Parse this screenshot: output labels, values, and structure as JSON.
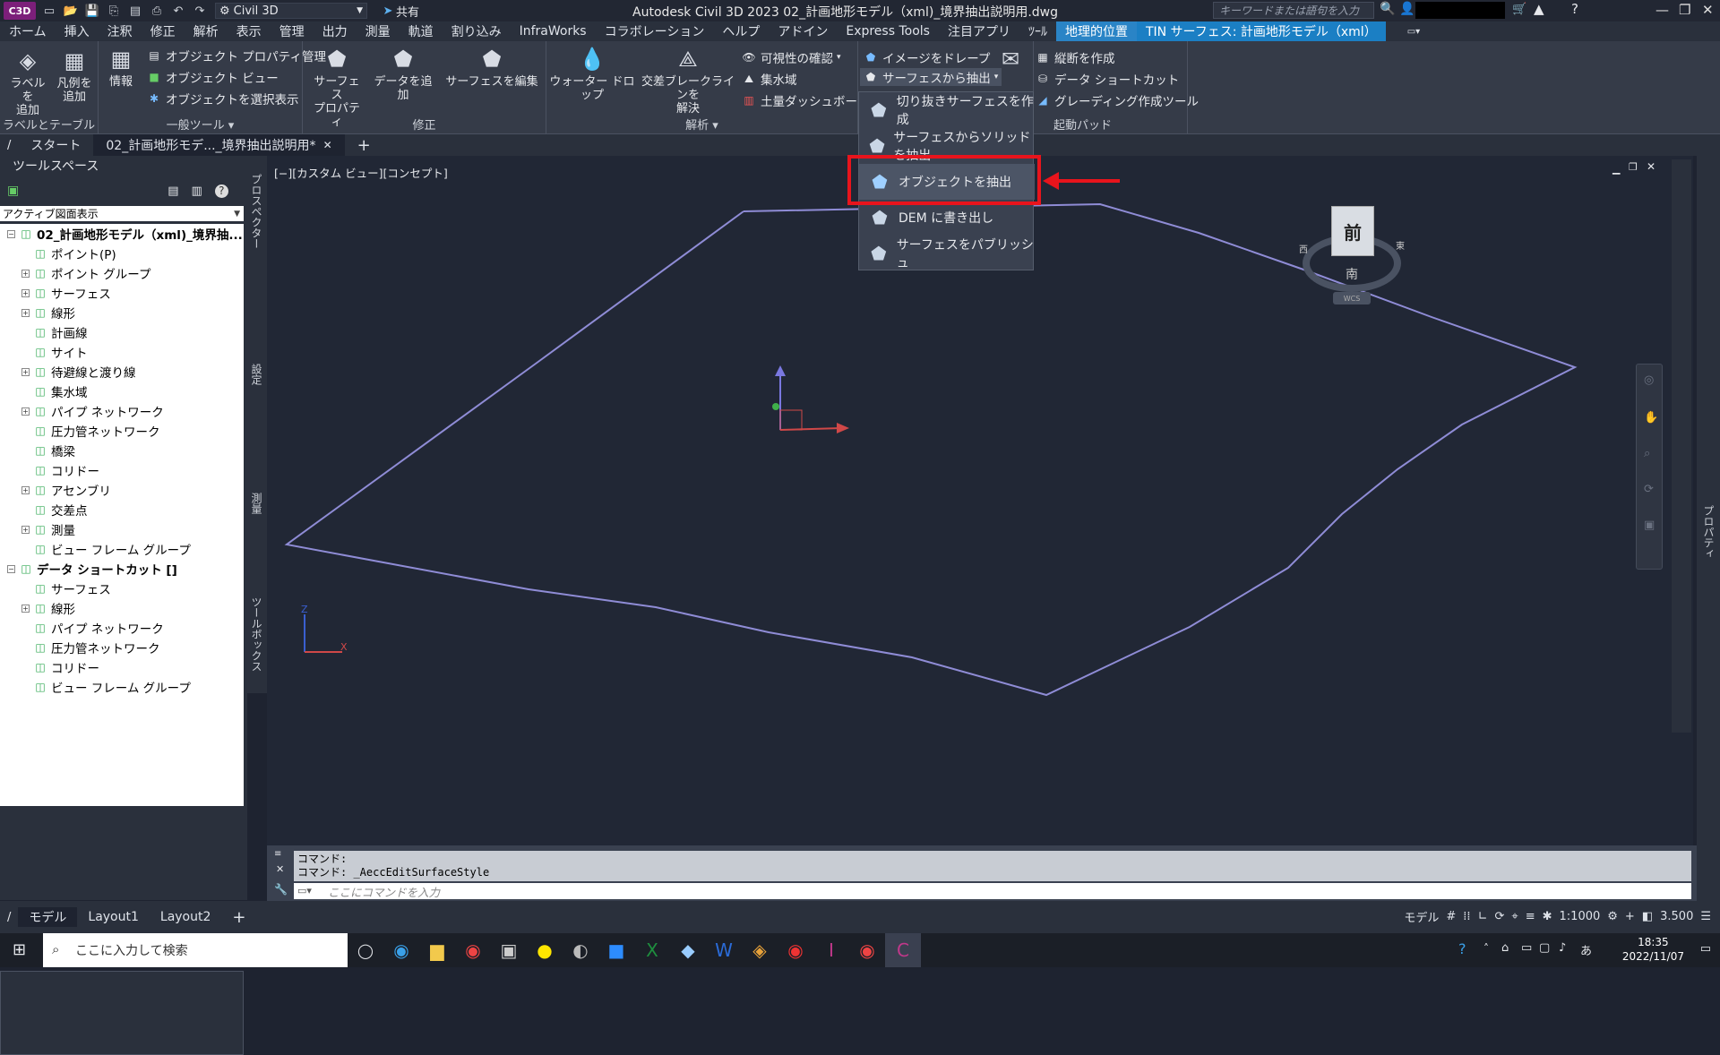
{
  "titlebar": {
    "logo": "C3D",
    "workspace": "Civil 3D",
    "share": "共有",
    "title": "Autodesk Civil 3D 2023    02_計画地形モデル（xml)_境界抽出説明用.dwg",
    "search_placeholder": "キーワードまたは語句を入力"
  },
  "tabs": [
    "ホーム",
    "挿入",
    "注釈",
    "修正",
    "解析",
    "表示",
    "管理",
    "出力",
    "測量",
    "軌道",
    "割り込み",
    "InfraWorks",
    "コラボレーション",
    "ヘルプ",
    "アドイン",
    "Express Tools",
    "注目アプリ",
    "ﾂｰﾙ",
    "地理的位置",
    "TIN サーフェス: 計画地形モデル（xml）"
  ],
  "ribbon": {
    "labels_panel": {
      "add_label": "ラベルを\n追加",
      "add_legend": "凡例を\n追加",
      "title": "ラベルとテーブル"
    },
    "general_panel": {
      "info": "情報",
      "obj_prop": "オブジェクト プロパティ管理",
      "obj_view": "オブジェクト ビュー",
      "obj_isolate": "オブジェクトを選択表示",
      "title": "一般ツール"
    },
    "modify_panel": {
      "surface_prop": "サーフェス\nプロパティ",
      "add_data": "データを追加",
      "edit_surface": "サーフェスを編集",
      "title": "修正"
    },
    "analysis_panel": {
      "water_drop": "ウォーター ドロップ",
      "breakline": "交差ブレークラインを\n解決",
      "visibility": "可視性の確認",
      "catchment": "集水域",
      "dashboard": "土量ダッシュボード",
      "title": "解析"
    },
    "extract_panel": {
      "drape": "イメージをドレープ",
      "extract_from": "サーフェスから抽出"
    },
    "launch_panel": {
      "create_profile": "縦断を作成",
      "shortcut": "データ ショートカット",
      "grading": "グレーディング作成ツール",
      "title": "起動パッド"
    }
  },
  "dropdown": {
    "items": [
      "切り抜きサーフェスを作成",
      "サーフェスからソリッドを抽出",
      "オブジェクトを抽出",
      "DEM に書き出し",
      "サーフェスをパブリッシュ"
    ]
  },
  "doctabs": [
    "スタート",
    "02_計画地形モデ..._境界抽出説明用*"
  ],
  "toolspace": {
    "header": "ツールスペース",
    "view": "アクティブ図面表示",
    "tree": [
      {
        "label": "02_計画地形モデル（xml)_境界抽...",
        "level": 0,
        "exp": "−"
      },
      {
        "label": "ポイント(P)",
        "level": 1,
        "exp": ""
      },
      {
        "label": "ポイント グループ",
        "level": 1,
        "exp": "+"
      },
      {
        "label": "サーフェス",
        "level": 1,
        "exp": "+"
      },
      {
        "label": "線形",
        "level": 1,
        "exp": "+"
      },
      {
        "label": "計画線",
        "level": 1,
        "exp": ""
      },
      {
        "label": "サイト",
        "level": 1,
        "exp": ""
      },
      {
        "label": "待避線と渡り線",
        "level": 1,
        "exp": "+"
      },
      {
        "label": "集水域",
        "level": 1,
        "exp": ""
      },
      {
        "label": "パイプ ネットワーク",
        "level": 1,
        "exp": "+"
      },
      {
        "label": "圧力管ネットワーク",
        "level": 1,
        "exp": ""
      },
      {
        "label": "橋梁",
        "level": 1,
        "exp": ""
      },
      {
        "label": "コリドー",
        "level": 1,
        "exp": ""
      },
      {
        "label": "アセンブリ",
        "level": 1,
        "exp": "+"
      },
      {
        "label": "交差点",
        "level": 1,
        "exp": ""
      },
      {
        "label": "測量",
        "level": 1,
        "exp": "+"
      },
      {
        "label": "ビュー フレーム グループ",
        "level": 1,
        "exp": ""
      },
      {
        "label": "データ ショートカット []",
        "level": 0,
        "exp": "−"
      },
      {
        "label": "サーフェス",
        "level": 1,
        "exp": ""
      },
      {
        "label": "線形",
        "level": 1,
        "exp": "+"
      },
      {
        "label": "パイプ ネットワーク",
        "level": 1,
        "exp": ""
      },
      {
        "label": "圧力管ネットワーク",
        "level": 1,
        "exp": ""
      },
      {
        "label": "コリドー",
        "level": 1,
        "exp": ""
      },
      {
        "label": "ビュー フレーム グループ",
        "level": 1,
        "exp": ""
      }
    ],
    "side_tabs": [
      "プロスペクター",
      "設定",
      "測量",
      "ツールボックス"
    ]
  },
  "viewport": {
    "label": "[−][カスタム ビュー][コンセプト]",
    "viewcube_face": "前",
    "viewcube_south": "南",
    "viewcube_west": "西",
    "viewcube_east": "東",
    "wcs": "WCS"
  },
  "cmdline": {
    "line1": "コマンド:",
    "line2": "コマンド: _AeccEditSurfaceStyle",
    "placeholder": "ここにコマンドを入力"
  },
  "properties_tab": "プロパティ",
  "layout_tabs": [
    "モデル",
    "Layout1",
    "Layout2"
  ],
  "status": {
    "model": "モデル",
    "scale": "1:1000",
    "value": "3.500"
  },
  "taskbar": {
    "search": "ここに入力して検索",
    "time": "18:35",
    "date": "2022/11/07"
  },
  "colors": {
    "accent": "#2a84c6",
    "highlight": "#e8141c",
    "boundary": "#8f8cd6"
  }
}
